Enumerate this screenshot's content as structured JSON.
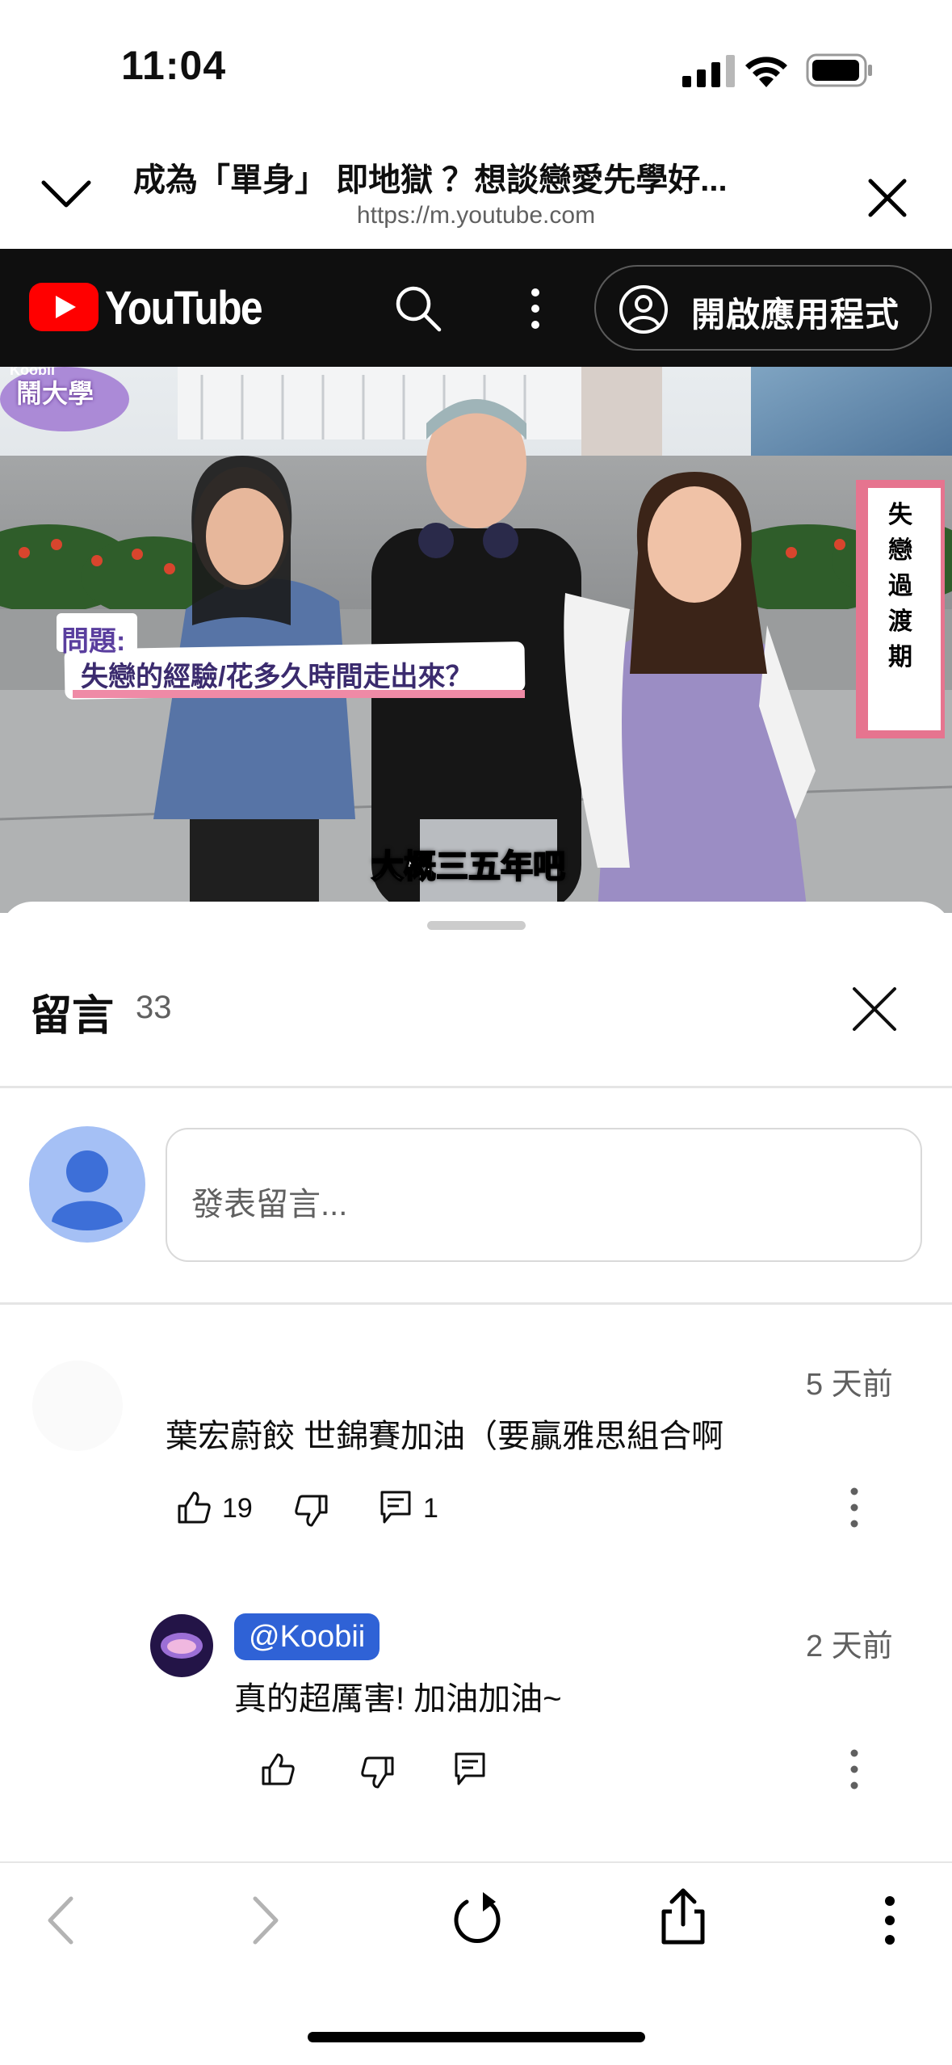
{
  "status_bar": {
    "time": "11:04"
  },
  "browser": {
    "title": "成為「單身」 即地獄 ？想談戀愛先學好...",
    "url": "https://m.youtube.com"
  },
  "youtube_bar": {
    "logo_text": "YouTube",
    "open_app_label": "開啟應用程式"
  },
  "video": {
    "logo_text": "鬧大學",
    "logo_brand": "Koobii",
    "question_label": "問題:",
    "question_text": "失戀的經驗/花多久時間走出來？",
    "subtitle": "大概三五年吧",
    "side_banner": "失戀過渡期"
  },
  "comments": {
    "title": "留言",
    "count": "33",
    "input_placeholder": "發表留言...",
    "items": [
      {
        "time": "5 天前",
        "text": "葉宏蔚餃 世錦賽加油（要贏雅思組合啊",
        "likes": "19",
        "replies": "1"
      }
    ],
    "replies": [
      {
        "author": "@Koobii",
        "time": "2 天前",
        "text": "真的超厲害! 加油加油~"
      }
    ]
  },
  "colors": {
    "youtube_red": "#FF0000",
    "mention_blue": "#2F62D6",
    "dark_bar": "#0F0F0F"
  }
}
